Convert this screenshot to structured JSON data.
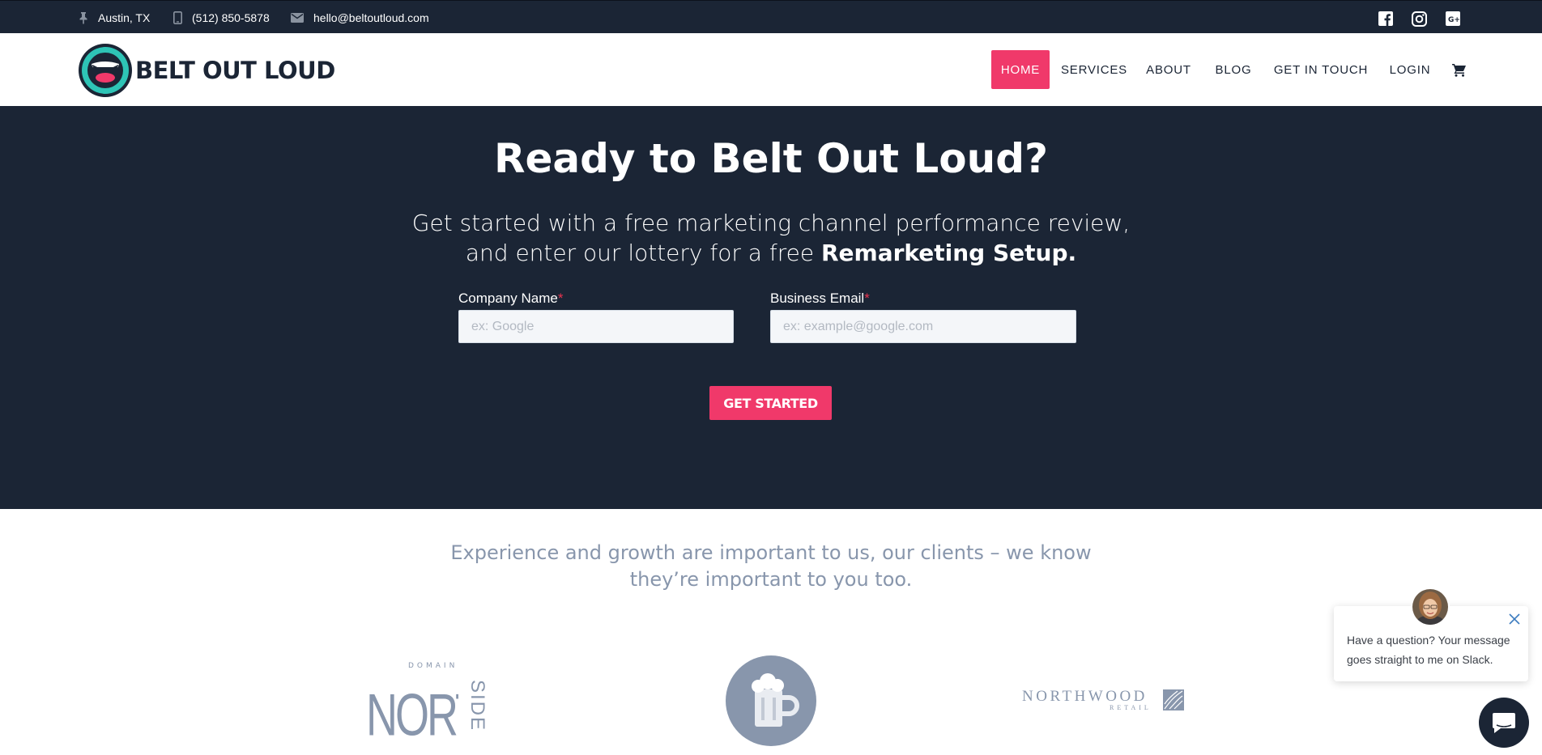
{
  "topbar": {
    "location": "Austin, TX",
    "phone": "(512) 850-5878",
    "email": "hello@beltoutloud.com",
    "social_icons": [
      "facebook-icon",
      "instagram-icon",
      "google-plus-icon"
    ]
  },
  "brand": {
    "name": "BELT OUT LOUD",
    "accent_color": "#f0396a",
    "dark_color": "#1b2535",
    "logo_ring_color": "#2ec4b6"
  },
  "nav": {
    "items": [
      {
        "label": "HOME",
        "active": true
      },
      {
        "label": "SERVICES",
        "active": false
      },
      {
        "label": "ABOUT",
        "active": false
      },
      {
        "label": "BLOG",
        "active": false
      },
      {
        "label": "GET IN TOUCH",
        "active": false
      },
      {
        "label": "LOGIN",
        "active": false
      }
    ],
    "cart_icon": "cart-icon"
  },
  "hero": {
    "title": "Ready to Belt Out Loud?",
    "subtitle_line1": "Get started with a free marketing channel performance review,",
    "subtitle_line2_prefix": "and enter our lottery for a free ",
    "subtitle_line2_bold": "Remarketing Setup.",
    "form": {
      "company": {
        "label": "Company Name",
        "required_mark": "*",
        "placeholder": "ex: Google",
        "value": ""
      },
      "email": {
        "label": "Business Email",
        "required_mark": "*",
        "placeholder": "ex: example@google.com",
        "value": ""
      },
      "submit_label": "GET STARTED"
    }
  },
  "clients": {
    "line1": "Experience and growth are important to us, our clients – we know",
    "line2": "they’re important to you too.",
    "logos": {
      "domain_northside": {
        "top": "DOMAIN",
        "main": "NORTH",
        "side": "SIDE"
      },
      "beer_mug": {
        "icon": "beer-mug-icon"
      },
      "northwood": {
        "main": "NORTHWOOD",
        "sub": "RETAIL"
      }
    },
    "logo_color": "#8896ac"
  },
  "chat": {
    "message": "Have a question? Your message goes straight to me on Slack.",
    "close_icon": "close-icon",
    "launcher_icon": "chat-bubble-icon"
  }
}
